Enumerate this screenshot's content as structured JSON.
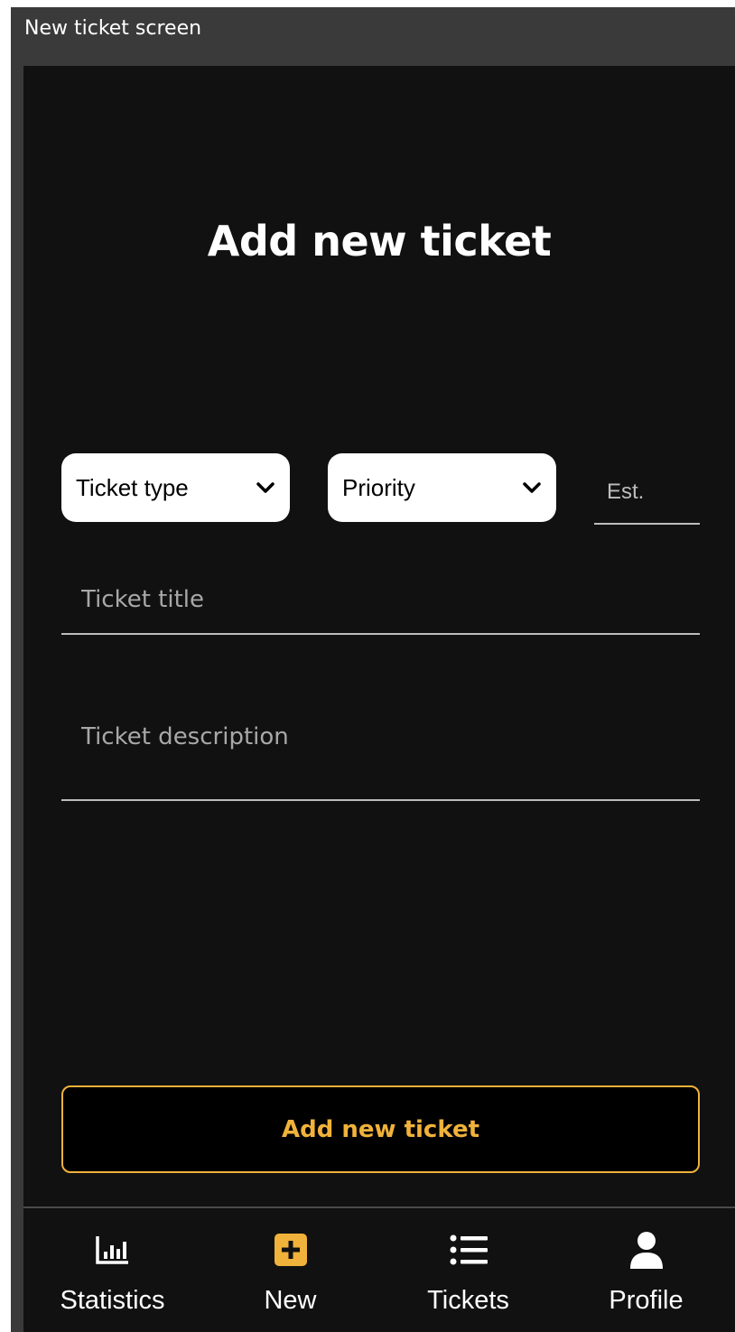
{
  "window": {
    "title": "New ticket screen"
  },
  "page": {
    "title": "Add new ticket"
  },
  "form": {
    "ticket_type": {
      "label": "Ticket type",
      "icon": "chevron-down-icon"
    },
    "priority": {
      "label": "Priority",
      "icon": "chevron-down-icon"
    },
    "estimate": {
      "placeholder": "Est.",
      "value": ""
    },
    "title": {
      "placeholder": "Ticket title",
      "value": ""
    },
    "description": {
      "placeholder": "Ticket description",
      "value": ""
    },
    "submit_label": "Add new ticket"
  },
  "nav": {
    "items": [
      {
        "label": "Statistics",
        "icon": "bar-chart-icon",
        "active": false
      },
      {
        "label": "New",
        "icon": "plus-square-icon",
        "active": true
      },
      {
        "label": "Tickets",
        "icon": "list-icon",
        "active": false
      },
      {
        "label": "Profile",
        "icon": "person-icon",
        "active": false
      }
    ]
  },
  "colors": {
    "background": "#111111",
    "accent": "#f0b23a",
    "text": "#ffffff",
    "field_underline": "#bdbdbd"
  }
}
